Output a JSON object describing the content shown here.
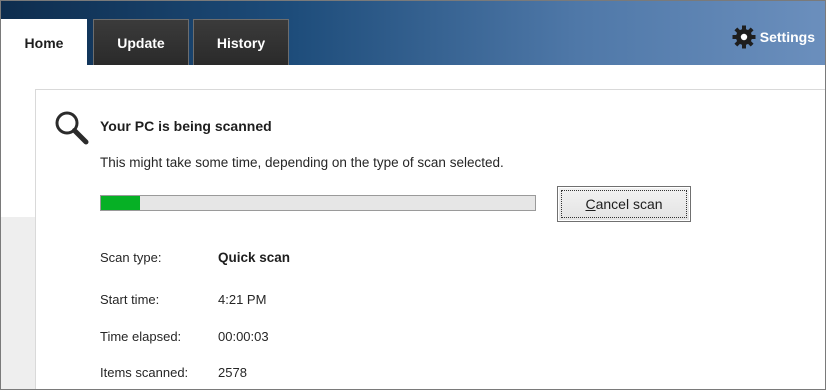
{
  "tabs": [
    {
      "label": "Home",
      "active": true
    },
    {
      "label": "Update",
      "active": false
    },
    {
      "label": "History",
      "active": false
    }
  ],
  "settings": {
    "label": "Settings",
    "icon": "gear-icon"
  },
  "scan": {
    "icon": "magnifier-icon",
    "title": "Your PC is being scanned",
    "description": "This might take some time, depending on the type of scan selected.",
    "progress_fraction": 0.09,
    "progress_color": "#06b025",
    "cancel_button": {
      "accel": "C",
      "rest": "ancel scan"
    }
  },
  "details": [
    {
      "label": "Scan type:",
      "value": "Quick scan",
      "bold": true
    },
    {
      "label": "Start time:",
      "value": "4:21 PM",
      "bold": false
    },
    {
      "label": "Time elapsed:",
      "value": "00:00:03",
      "bold": false
    },
    {
      "label": "Items scanned:",
      "value": "2578",
      "bold": false
    }
  ]
}
